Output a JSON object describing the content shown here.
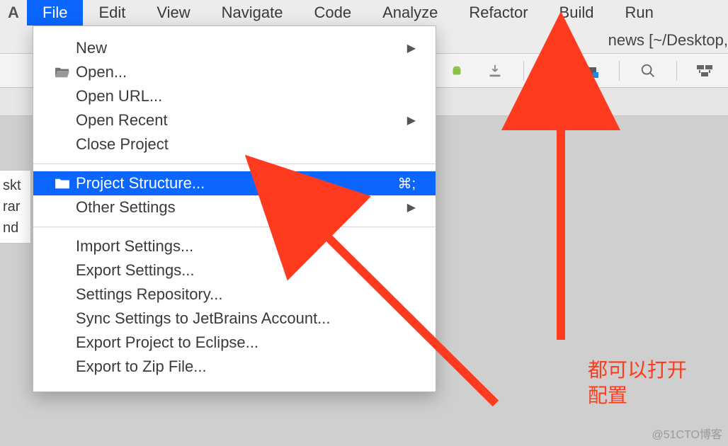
{
  "menubar": {
    "logo": "A",
    "items": [
      "File",
      "Edit",
      "View",
      "Navigate",
      "Code",
      "Analyze",
      "Refactor",
      "Build",
      "Run"
    ],
    "active_index": 0
  },
  "titlebar": {
    "text": "news [~/Desktop,"
  },
  "left_strip": {
    "lines": [
      "skt",
      "rar",
      "nd"
    ]
  },
  "dropdown": {
    "groups": [
      [
        {
          "label": "New",
          "icon": "",
          "has_sub": true
        },
        {
          "label": "Open...",
          "icon": "folder-open"
        },
        {
          "label": "Open URL..."
        },
        {
          "label": "Open Recent",
          "has_sub": true
        },
        {
          "label": "Close Project"
        }
      ],
      [
        {
          "label": "Project Structure...",
          "icon": "folder",
          "shortcut": "⌘;",
          "highlight": true
        },
        {
          "label": "Other Settings",
          "has_sub": true
        }
      ],
      [
        {
          "label": "Import Settings..."
        },
        {
          "label": "Export Settings..."
        },
        {
          "label": "Settings Repository..."
        },
        {
          "label": "Sync Settings to JetBrains Account..."
        },
        {
          "label": "Export Project to Eclipse..."
        },
        {
          "label": "Export to Zip File..."
        }
      ]
    ]
  },
  "toolbar_icons": [
    "android-icon",
    "download-icon",
    "wrench-icon",
    "project-structure-icon",
    "search-icon",
    "layout-icon"
  ],
  "annotation": {
    "line1": "都可以打开",
    "line2": "配置"
  },
  "watermark": "@51CTO博客"
}
